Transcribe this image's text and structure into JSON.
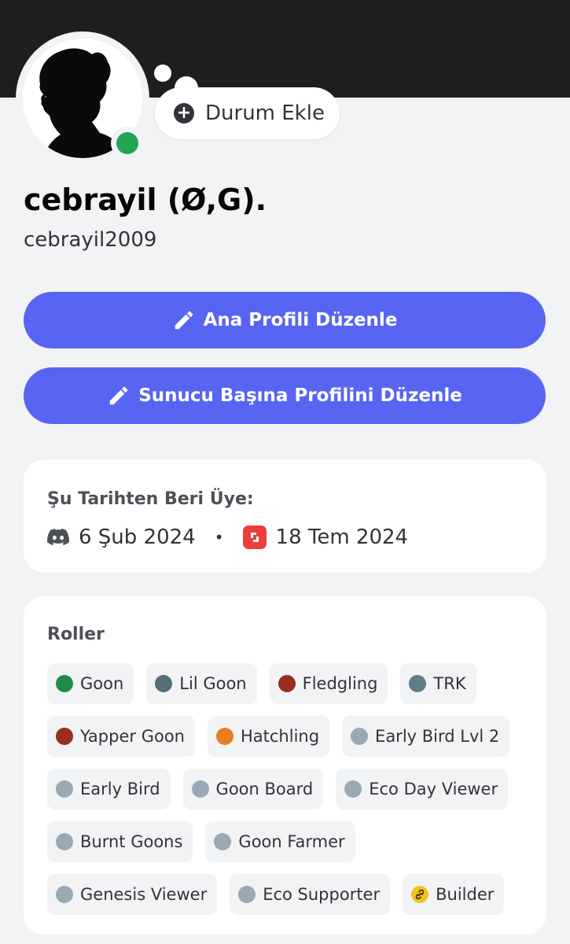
{
  "profile": {
    "display_name": "cebrayil (Ø,G).",
    "username": "cebrayil2009",
    "online_status_color": "#23a559",
    "avatar_icon": "silhouette-avatar"
  },
  "status": {
    "add_label": "Durum Ekle",
    "icon": "plus-circle-icon"
  },
  "actions": {
    "edit_main_profile": "Ana Profili Düzenle",
    "edit_server_profile": "Sunucu Başına Profilini Düzenle",
    "icon": "pencil-icon",
    "accent": "#5865f2"
  },
  "member_since": {
    "title": "Şu Tarihten Beri Üye:",
    "discord_date": "6 Şub 2024",
    "separator": "•",
    "server_date": "18 Tem 2024"
  },
  "roles": {
    "title": "Roller",
    "items": [
      {
        "name": "Goon",
        "color": "#1f8b4c"
      },
      {
        "name": "Lil Goon",
        "color": "#546e7a"
      },
      {
        "name": "Fledgling",
        "color": "#992d22"
      },
      {
        "name": "TRK",
        "color": "#607d8b"
      },
      {
        "name": "Yapper Goon",
        "color": "#992d22"
      },
      {
        "name": "Hatchling",
        "color": "#e67e22"
      },
      {
        "name": "Early Bird Lvl 2",
        "color": "#99aab5"
      },
      {
        "name": "Early Bird",
        "color": "#99aab5"
      },
      {
        "name": "Goon Board",
        "color": "#99aab5"
      },
      {
        "name": "Eco Day Viewer",
        "color": "#99aab5"
      },
      {
        "name": "Burnt Goons",
        "color": "#99aab5"
      },
      {
        "name": "Goon Farmer",
        "color": "#99aab5"
      },
      {
        "name": "Genesis Viewer",
        "color": "#99aab5"
      },
      {
        "name": "Eco Supporter",
        "color": "#99aab5"
      },
      {
        "name": "Builder",
        "color": "#f0c420",
        "icon": "link-icon"
      }
    ]
  }
}
